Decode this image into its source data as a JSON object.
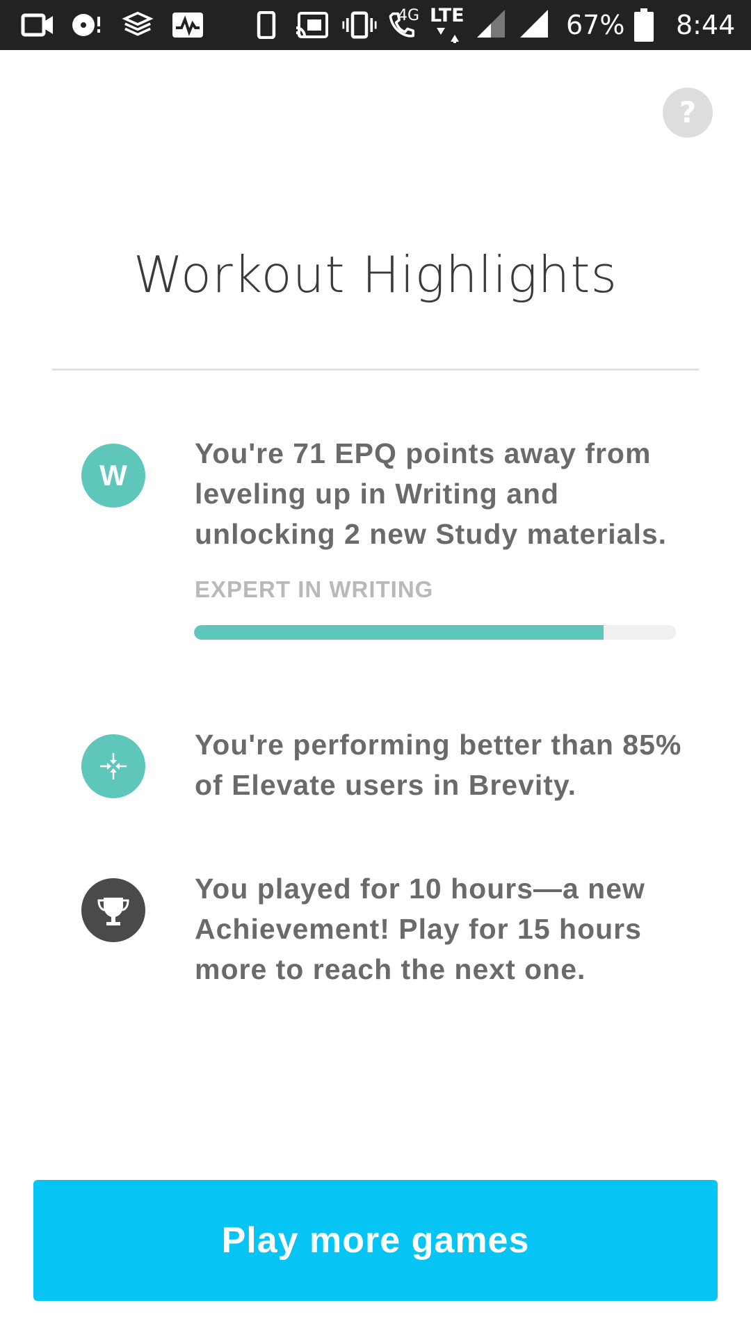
{
  "status_bar": {
    "network_type": "4G",
    "lte_label": "LTE",
    "battery_percent": "67%",
    "time": "8:44",
    "icons": [
      "video-camera-icon",
      "disc-notification-icon",
      "stack-app-icon",
      "activity-monitor-icon",
      "phone-device-icon",
      "cast-icon",
      "vibrate-icon",
      "wifi-call-icon",
      "lte-data-icon",
      "signal-icon",
      "signal-icon",
      "battery-icon"
    ]
  },
  "help": {
    "label": "?"
  },
  "page": {
    "title": "Workout Highlights"
  },
  "highlights": [
    {
      "icon": "writing-letter-icon",
      "icon_letter": "W",
      "icon_color": "#5ec6bb",
      "text": "You're 71 EPQ points away from leveling up in Writing and unlocking 2 new Study materials.",
      "skill_label": "EXPERT IN WRITING",
      "progress": 0.85
    },
    {
      "icon": "compress-arrows-icon",
      "icon_color": "#5ec6bb",
      "text": "You're performing better than 85% of Elevate users in Brevity."
    },
    {
      "icon": "trophy-icon",
      "icon_color": "#4a4a4a",
      "text": "You played for 10 hours—a new Achievement! Play for 15 hours more to reach the next one."
    }
  ],
  "cta": {
    "label": "Play more games",
    "color": "#06c4f4"
  }
}
